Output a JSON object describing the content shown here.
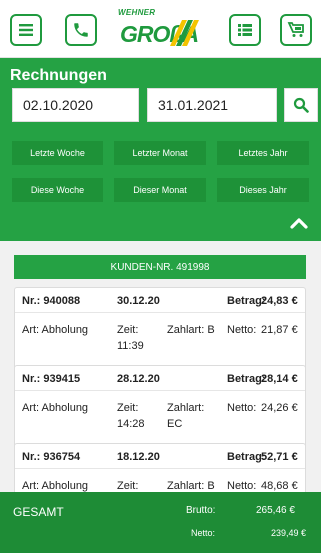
{
  "header": {
    "logo_top": "WEHNER",
    "logo_main": "GROßA",
    "icons": [
      "menu-icon",
      "phone-icon",
      "list-icon",
      "cart-icon"
    ]
  },
  "invoices_panel": {
    "title": "Rechnungen",
    "date_from": "02.10.2020",
    "date_to": "31.01.2021",
    "ranges": [
      "Letzte Woche",
      "Letzter Monat",
      "Letztes Jahr",
      "Diese Woche",
      "Dieser Monat",
      "Dieses Jahr"
    ]
  },
  "customer": {
    "label": "KUNDEN-NR. 491998"
  },
  "invoices": [
    {
      "nr": "Nr.: 940088",
      "date": "30.12.20",
      "betrag_label": "Betrag:",
      "betrag": "24,83 €",
      "art": "Art: Abholung",
      "zeit_label": "Zeit:",
      "zeit": "11:39",
      "zahlart_label": "Zahlart: B",
      "zahlart_value": "",
      "netto_label": "Netto:",
      "netto": "21,87 €"
    },
    {
      "nr": "Nr.: 939415",
      "date": "28.12.20",
      "betrag_label": "Betrag:",
      "betrag": "28,14 €",
      "art": "Art: Abholung",
      "zeit_label": "Zeit:",
      "zeit": "14:28",
      "zahlart_label": "Zahlart:",
      "zahlart_value": "EC",
      "netto_label": "Netto:",
      "netto": "24,26 €"
    },
    {
      "nr": "Nr.: 936754",
      "date": "18.12.20",
      "betrag_label": "Betrag:",
      "betrag": "52,71 €",
      "art": "Art: Abholung",
      "zeit_label": "Zeit:",
      "zeit": "",
      "zahlart_label": "Zahlart: B",
      "zahlart_value": "",
      "netto_label": "Netto:",
      "netto": "48,68 €"
    }
  ],
  "totals": {
    "label": "GESAMT",
    "brutto_label": "Brutto:",
    "brutto": "265,46 €",
    "netto_label": "Netto:",
    "netto": "239,49 €"
  },
  "colors": {
    "brand_green": "#25a244",
    "dark_green": "#1e8c36",
    "button_green": "#1e9238"
  }
}
